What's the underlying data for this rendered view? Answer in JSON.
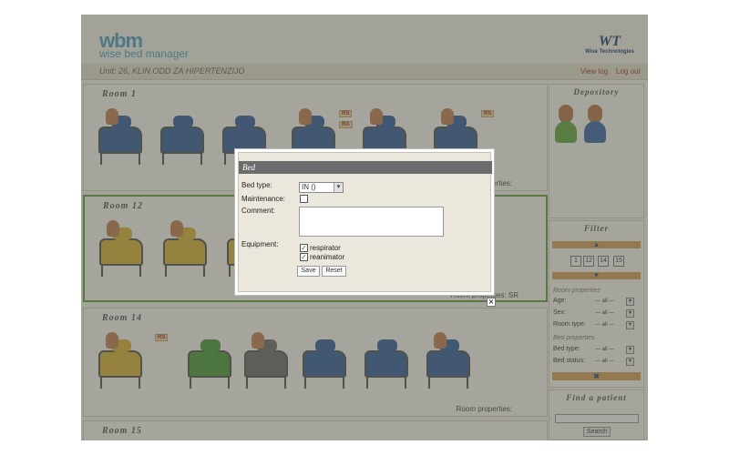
{
  "header": {
    "logo_short": "wbm",
    "logo_text": "wise bed manager",
    "company_logo": "WT",
    "company_name": "Wise Technologies"
  },
  "unit_bar": {
    "title": "Unit: 26, KLIN ODD ZA HIPERTENZIJO",
    "view_log": "View log",
    "logout": "Log out"
  },
  "rooms": [
    {
      "title": "Room 1",
      "properties_label": "Room properties:",
      "badges": [
        "RS",
        "RA",
        "RS"
      ]
    },
    {
      "title": "Room 12",
      "properties_label": "Room properties: SR",
      "badges": []
    },
    {
      "title": "Room 14",
      "properties_label": "Room properties:",
      "badges": [
        "RS"
      ]
    },
    {
      "title": "Room 15"
    }
  ],
  "sidebar": {
    "depository": {
      "title": "Depository"
    },
    "filter": {
      "title": "Filter",
      "pages": [
        "1",
        "12",
        "14",
        "15"
      ],
      "room_properties_title": "Room properties",
      "bed_properties_title": "Bed properties",
      "fields": [
        {
          "label": "Age:",
          "value": "--- all ---"
        },
        {
          "label": "Sex:",
          "value": "--- all ---"
        },
        {
          "label": "Room type:",
          "value": "--- all ---"
        },
        {
          "label": "Bed type:",
          "value": "--- all ---"
        },
        {
          "label": "Bed status:",
          "value": "--- all ---"
        }
      ]
    },
    "find_patient": {
      "title": "Find a patient",
      "search_label": "Search"
    }
  },
  "modal": {
    "title": "Bed",
    "bed_type_label": "Bed type:",
    "bed_type_value": "IN ()",
    "maintenance_label": "Maintenance:",
    "maintenance_checked": false,
    "comment_label": "Comment:",
    "comment_value": "",
    "equipment_label": "Equipment:",
    "equipment": [
      {
        "label": "respirator",
        "checked": true
      },
      {
        "label": "reanimator",
        "checked": true
      }
    ],
    "save_label": "Save",
    "reset_label": "Reset",
    "close_glyph": "×"
  },
  "icons": {
    "arrow_up": "▲",
    "arrow_down": "▼",
    "select_arrow": "▾",
    "clear_filter": "✖",
    "check": "✓"
  },
  "colors": {
    "bed_blue": "#35609e",
    "bed_yellow": "#d9b437",
    "bed_green": "#4b9a3a",
    "bed_dark": "#6f6f6f",
    "selected_room_border": "#5aa040",
    "accent_orange": "#d9a35a"
  }
}
